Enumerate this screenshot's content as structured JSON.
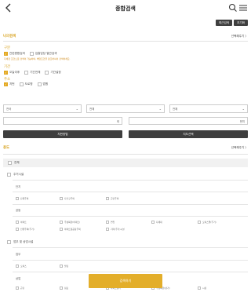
{
  "header": {
    "title": "종합검색"
  },
  "toolbar": {
    "reset_label": "최근검색",
    "init_label": "초기화"
  },
  "location_section": {
    "title": "나의검색",
    "fold_label": "선택해주기 〉"
  },
  "category_group": {
    "label": "구분",
    "options": [
      {
        "label": "관련총합검색",
        "checked": true
      },
      {
        "label": "입찰담당 열관검색",
        "checked": false
      }
    ],
    "note": "다세한 조건으로 검색이 가능하며, 해당조건을 참조하셔서 검색하세요."
  },
  "period_group": {
    "label": "기간",
    "options": [
      {
        "label": "오늘이후",
        "checked": true
      },
      {
        "label": "기간전체",
        "checked": false
      },
      {
        "label": "기간설정",
        "checked": false
      }
    ]
  },
  "address_group": {
    "label": "주소",
    "options": [
      {
        "label": "지번",
        "checked": true
      },
      {
        "label": "도로명",
        "checked": false
      },
      {
        "label": "법원",
        "checked": false
      }
    ],
    "selects": [
      "전국",
      "전체",
      "전체"
    ],
    "detail_unit": "외",
    "detail_unit2": "번지",
    "buttons": {
      "map_label": "지번방법",
      "area_label": "지도선택"
    }
  },
  "usage_section": {
    "title": "용도",
    "fold_label": "선택해주기 〉",
    "all_label": "전체",
    "residential": {
      "label": "주거시설",
      "sub1": "단지",
      "sub1_options": [
        "단독주택",
        "다가구주택",
        "근린주택"
      ],
      "sub2": "공동",
      "sub2_options": [
        "아파트",
        "주상복합(아파트)",
        "연립",
        "다세대",
        "오피스텔(주거)",
        "전원주택(주거)",
        "아파트형공장주택",
        "기타(주거)시설"
      ]
    },
    "commercial": {
      "label": "업무 및 상업시설",
      "sub1": "업무",
      "sub1_options": [
        "오피스",
        "빌딩"
      ],
      "sub2": "상업",
      "sub2_options": [
        "근린",
        "점포",
        "아파트상가",
        "주상복합(상가)",
        "시장"
      ]
    }
  },
  "search_button": {
    "label": "검색하기"
  }
}
